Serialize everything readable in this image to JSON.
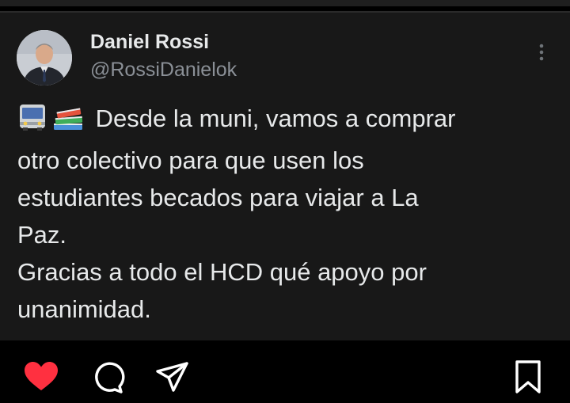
{
  "post": {
    "display_name": "Daniel Rossi",
    "handle": "@RossiDanielok",
    "emojis": [
      "bus-emoji",
      "books-emoji"
    ],
    "text": " Desde la muni, vamos a comprar\notro colectivo para que usen los\nestudiantes becados para viajar a La\nPaz.\nGracias a todo el HCD qué apoyo por\nunanimidad."
  },
  "actions": {
    "like": {
      "icon": "heart-icon",
      "state": "liked",
      "color": "#ff3040"
    },
    "comment": {
      "icon": "comment-icon"
    },
    "share": {
      "icon": "send-icon"
    },
    "save": {
      "icon": "bookmark-icon"
    }
  },
  "colors": {
    "background": "#000000",
    "card": "#181818",
    "text": "#e7e9ea",
    "handle": "#8b9097"
  }
}
